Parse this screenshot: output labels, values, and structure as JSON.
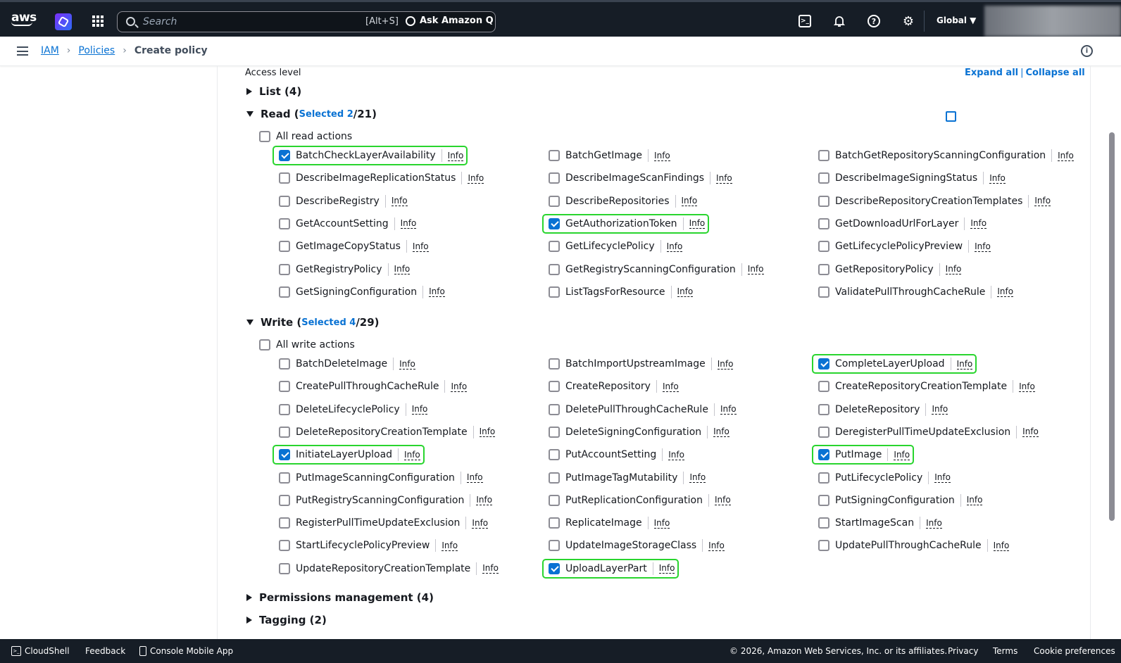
{
  "topnav": {
    "logo": "aws",
    "search_placeholder": "Search",
    "search_shortcut": "[Alt+S]",
    "ask_q": "Ask Amazon Q",
    "region": "Global ▼",
    "icons": [
      "cloudshell-icon",
      "bell-icon",
      "help-icon",
      "gear-icon"
    ]
  },
  "breadcrumb": {
    "items": [
      "IAM",
      "Policies"
    ],
    "current": "Create policy"
  },
  "access": {
    "label": "Access level",
    "expand_all": "Expand all",
    "separator": "|",
    "collapse_all": "Collapse all"
  },
  "groups": {
    "list": {
      "label": "List (4)"
    },
    "read": {
      "label": "Read (",
      "selected": "Selected 2",
      "total": "/21)",
      "all": "All read actions",
      "actions": [
        {
          "name": "BatchCheckLayerAvailability",
          "checked": true
        },
        {
          "name": "BatchGetImage",
          "checked": false
        },
        {
          "name": "BatchGetRepositoryScanningConfiguration",
          "checked": false
        },
        {
          "name": "DescribeImageReplicationStatus",
          "checked": false
        },
        {
          "name": "DescribeImageScanFindings",
          "checked": false
        },
        {
          "name": "DescribeImageSigningStatus",
          "checked": false
        },
        {
          "name": "DescribeRegistry",
          "checked": false
        },
        {
          "name": "DescribeRepositories",
          "checked": false
        },
        {
          "name": "DescribeRepositoryCreationTemplates",
          "checked": false
        },
        {
          "name": "GetAccountSetting",
          "checked": false
        },
        {
          "name": "GetAuthorizationToken",
          "checked": true
        },
        {
          "name": "GetDownloadUrlForLayer",
          "checked": false
        },
        {
          "name": "GetImageCopyStatus",
          "checked": false
        },
        {
          "name": "GetLifecyclePolicy",
          "checked": false
        },
        {
          "name": "GetLifecyclePolicyPreview",
          "checked": false
        },
        {
          "name": "GetRegistryPolicy",
          "checked": false
        },
        {
          "name": "GetRegistryScanningConfiguration",
          "checked": false
        },
        {
          "name": "GetRepositoryPolicy",
          "checked": false
        },
        {
          "name": "GetSigningConfiguration",
          "checked": false
        },
        {
          "name": "ListTagsForResource",
          "checked": false
        },
        {
          "name": "ValidatePullThroughCacheRule",
          "checked": false
        }
      ]
    },
    "write": {
      "label": "Write (",
      "selected": "Selected 4",
      "total": "/29)",
      "all": "All write actions",
      "actions": [
        {
          "name": "BatchDeleteImage",
          "checked": false
        },
        {
          "name": "BatchImportUpstreamImage",
          "checked": false
        },
        {
          "name": "CompleteLayerUpload",
          "checked": true
        },
        {
          "name": "CreatePullThroughCacheRule",
          "checked": false
        },
        {
          "name": "CreateRepository",
          "checked": false
        },
        {
          "name": "CreateRepositoryCreationTemplate",
          "checked": false
        },
        {
          "name": "DeleteLifecyclePolicy",
          "checked": false
        },
        {
          "name": "DeletePullThroughCacheRule",
          "checked": false
        },
        {
          "name": "DeleteRepository",
          "checked": false
        },
        {
          "name": "DeleteRepositoryCreationTemplate",
          "checked": false
        },
        {
          "name": "DeleteSigningConfiguration",
          "checked": false
        },
        {
          "name": "DeregisterPullTimeUpdateExclusion",
          "checked": false
        },
        {
          "name": "InitiateLayerUpload",
          "checked": true
        },
        {
          "name": "PutAccountSetting",
          "checked": false
        },
        {
          "name": "PutImage",
          "checked": true
        },
        {
          "name": "PutImageScanningConfiguration",
          "checked": false
        },
        {
          "name": "PutImageTagMutability",
          "checked": false
        },
        {
          "name": "PutLifecyclePolicy",
          "checked": false
        },
        {
          "name": "PutRegistryScanningConfiguration",
          "checked": false
        },
        {
          "name": "PutReplicationConfiguration",
          "checked": false
        },
        {
          "name": "PutSigningConfiguration",
          "checked": false
        },
        {
          "name": "RegisterPullTimeUpdateExclusion",
          "checked": false
        },
        {
          "name": "ReplicateImage",
          "checked": false
        },
        {
          "name": "StartImageScan",
          "checked": false
        },
        {
          "name": "StartLifecyclePolicyPreview",
          "checked": false
        },
        {
          "name": "UpdateImageStorageClass",
          "checked": false
        },
        {
          "name": "UpdatePullThroughCacheRule",
          "checked": false
        },
        {
          "name": "UpdateRepositoryCreationTemplate",
          "checked": false
        },
        {
          "name": "UploadLayerPart",
          "checked": true
        }
      ]
    },
    "permissions": {
      "label": "Permissions management (4)"
    },
    "tagging": {
      "label": "Tagging (2)"
    }
  },
  "info_label": "Info",
  "footer": {
    "cloudshell": "CloudShell",
    "feedback": "Feedback",
    "mobile": "Console Mobile App",
    "copyright": "© 2026, Amazon Web Services, Inc. or its affiliates.",
    "privacy": "Privacy",
    "terms": "Terms",
    "cookies": "Cookie preferences"
  },
  "colors": {
    "nav_bg": "#161d26",
    "link": "#0972d3",
    "highlight": "#29d52e",
    "checkbox_on": "#0972d3"
  }
}
